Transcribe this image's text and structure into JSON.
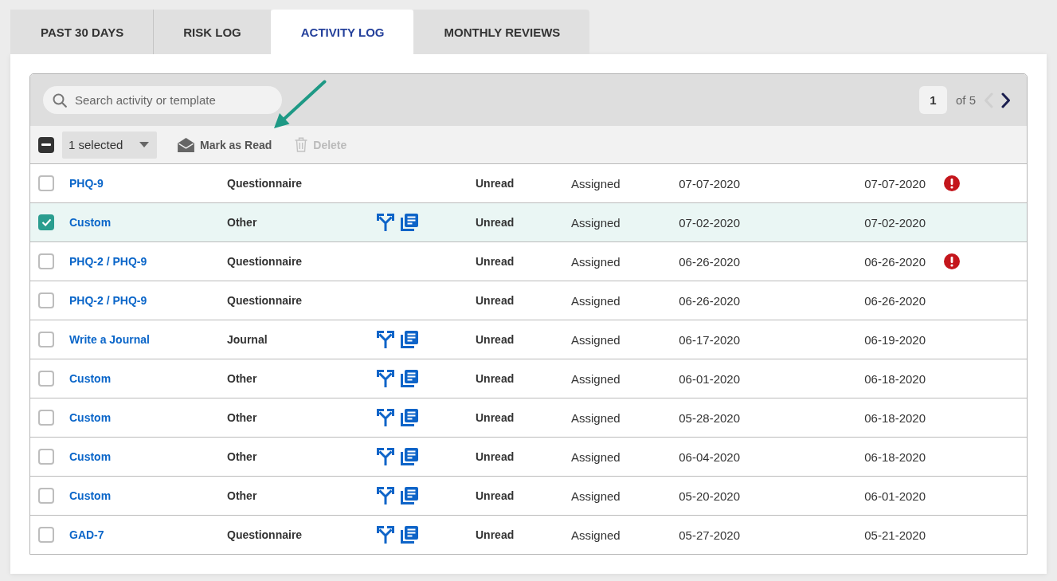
{
  "tabs": [
    {
      "label": "PAST 30 DAYS",
      "selected": false
    },
    {
      "label": "RISK LOG",
      "selected": false
    },
    {
      "label": "ACTIVITY LOG",
      "selected": true
    },
    {
      "label": "MONTHLY REVIEWS",
      "selected": false
    }
  ],
  "search": {
    "placeholder": "Search activity or template"
  },
  "pagination": {
    "page": "1",
    "total": "of 5",
    "previous": {
      "disabled": true
    },
    "next": {
      "disabled": false
    }
  },
  "toolbar": {
    "select_all": {
      "indeterminate": true
    },
    "selection": "1 selected",
    "actions": [
      {
        "label": "Mark as Read",
        "kind": "envelope",
        "disabled": false
      },
      {
        "label": "Delete",
        "kind": "trash",
        "disabled": true
      }
    ]
  },
  "rows": [
    {
      "selected": false,
      "cells": [
        "PHQ-9",
        "Questionnaire",
        "Unread",
        "Assigned",
        "07-07-2020",
        "07-07-2020"
      ],
      "icons": false,
      "alert": true
    },
    {
      "selected": true,
      "cells": [
        "Custom",
        "Other",
        "Unread",
        "Assigned",
        "07-02-2020",
        "07-02-2020"
      ],
      "icons": true,
      "alert": false
    },
    {
      "selected": false,
      "cells": [
        "PHQ-2 / PHQ-9",
        "Questionnaire",
        "Unread",
        "Assigned",
        "06-26-2020",
        "06-26-2020"
      ],
      "icons": false,
      "alert": true
    },
    {
      "selected": false,
      "cells": [
        "PHQ-2 / PHQ-9",
        "Questionnaire",
        "Unread",
        "Assigned",
        "06-26-2020",
        "06-26-2020"
      ],
      "icons": false,
      "alert": false
    },
    {
      "selected": false,
      "cells": [
        "Write a Journal",
        "Journal",
        "Unread",
        "Assigned",
        "06-17-2020",
        "06-19-2020"
      ],
      "icons": true,
      "alert": false
    },
    {
      "selected": false,
      "cells": [
        "Custom",
        "Other",
        "Unread",
        "Assigned",
        "06-01-2020",
        "06-18-2020"
      ],
      "icons": true,
      "alert": false
    },
    {
      "selected": false,
      "cells": [
        "Custom",
        "Other",
        "Unread",
        "Assigned",
        "05-28-2020",
        "06-18-2020"
      ],
      "icons": true,
      "alert": false
    },
    {
      "selected": false,
      "cells": [
        "Custom",
        "Other",
        "Unread",
        "Assigned",
        "06-04-2020",
        "06-18-2020"
      ],
      "icons": true,
      "alert": false
    },
    {
      "selected": false,
      "cells": [
        "Custom",
        "Other",
        "Unread",
        "Assigned",
        "05-20-2020",
        "06-01-2020"
      ],
      "icons": true,
      "alert": false
    },
    {
      "selected": false,
      "cells": [
        "GAD-7",
        "Questionnaire",
        "Unread",
        "Assigned",
        "05-27-2020",
        "05-21-2020"
      ],
      "icons": true,
      "alert": false
    }
  ]
}
